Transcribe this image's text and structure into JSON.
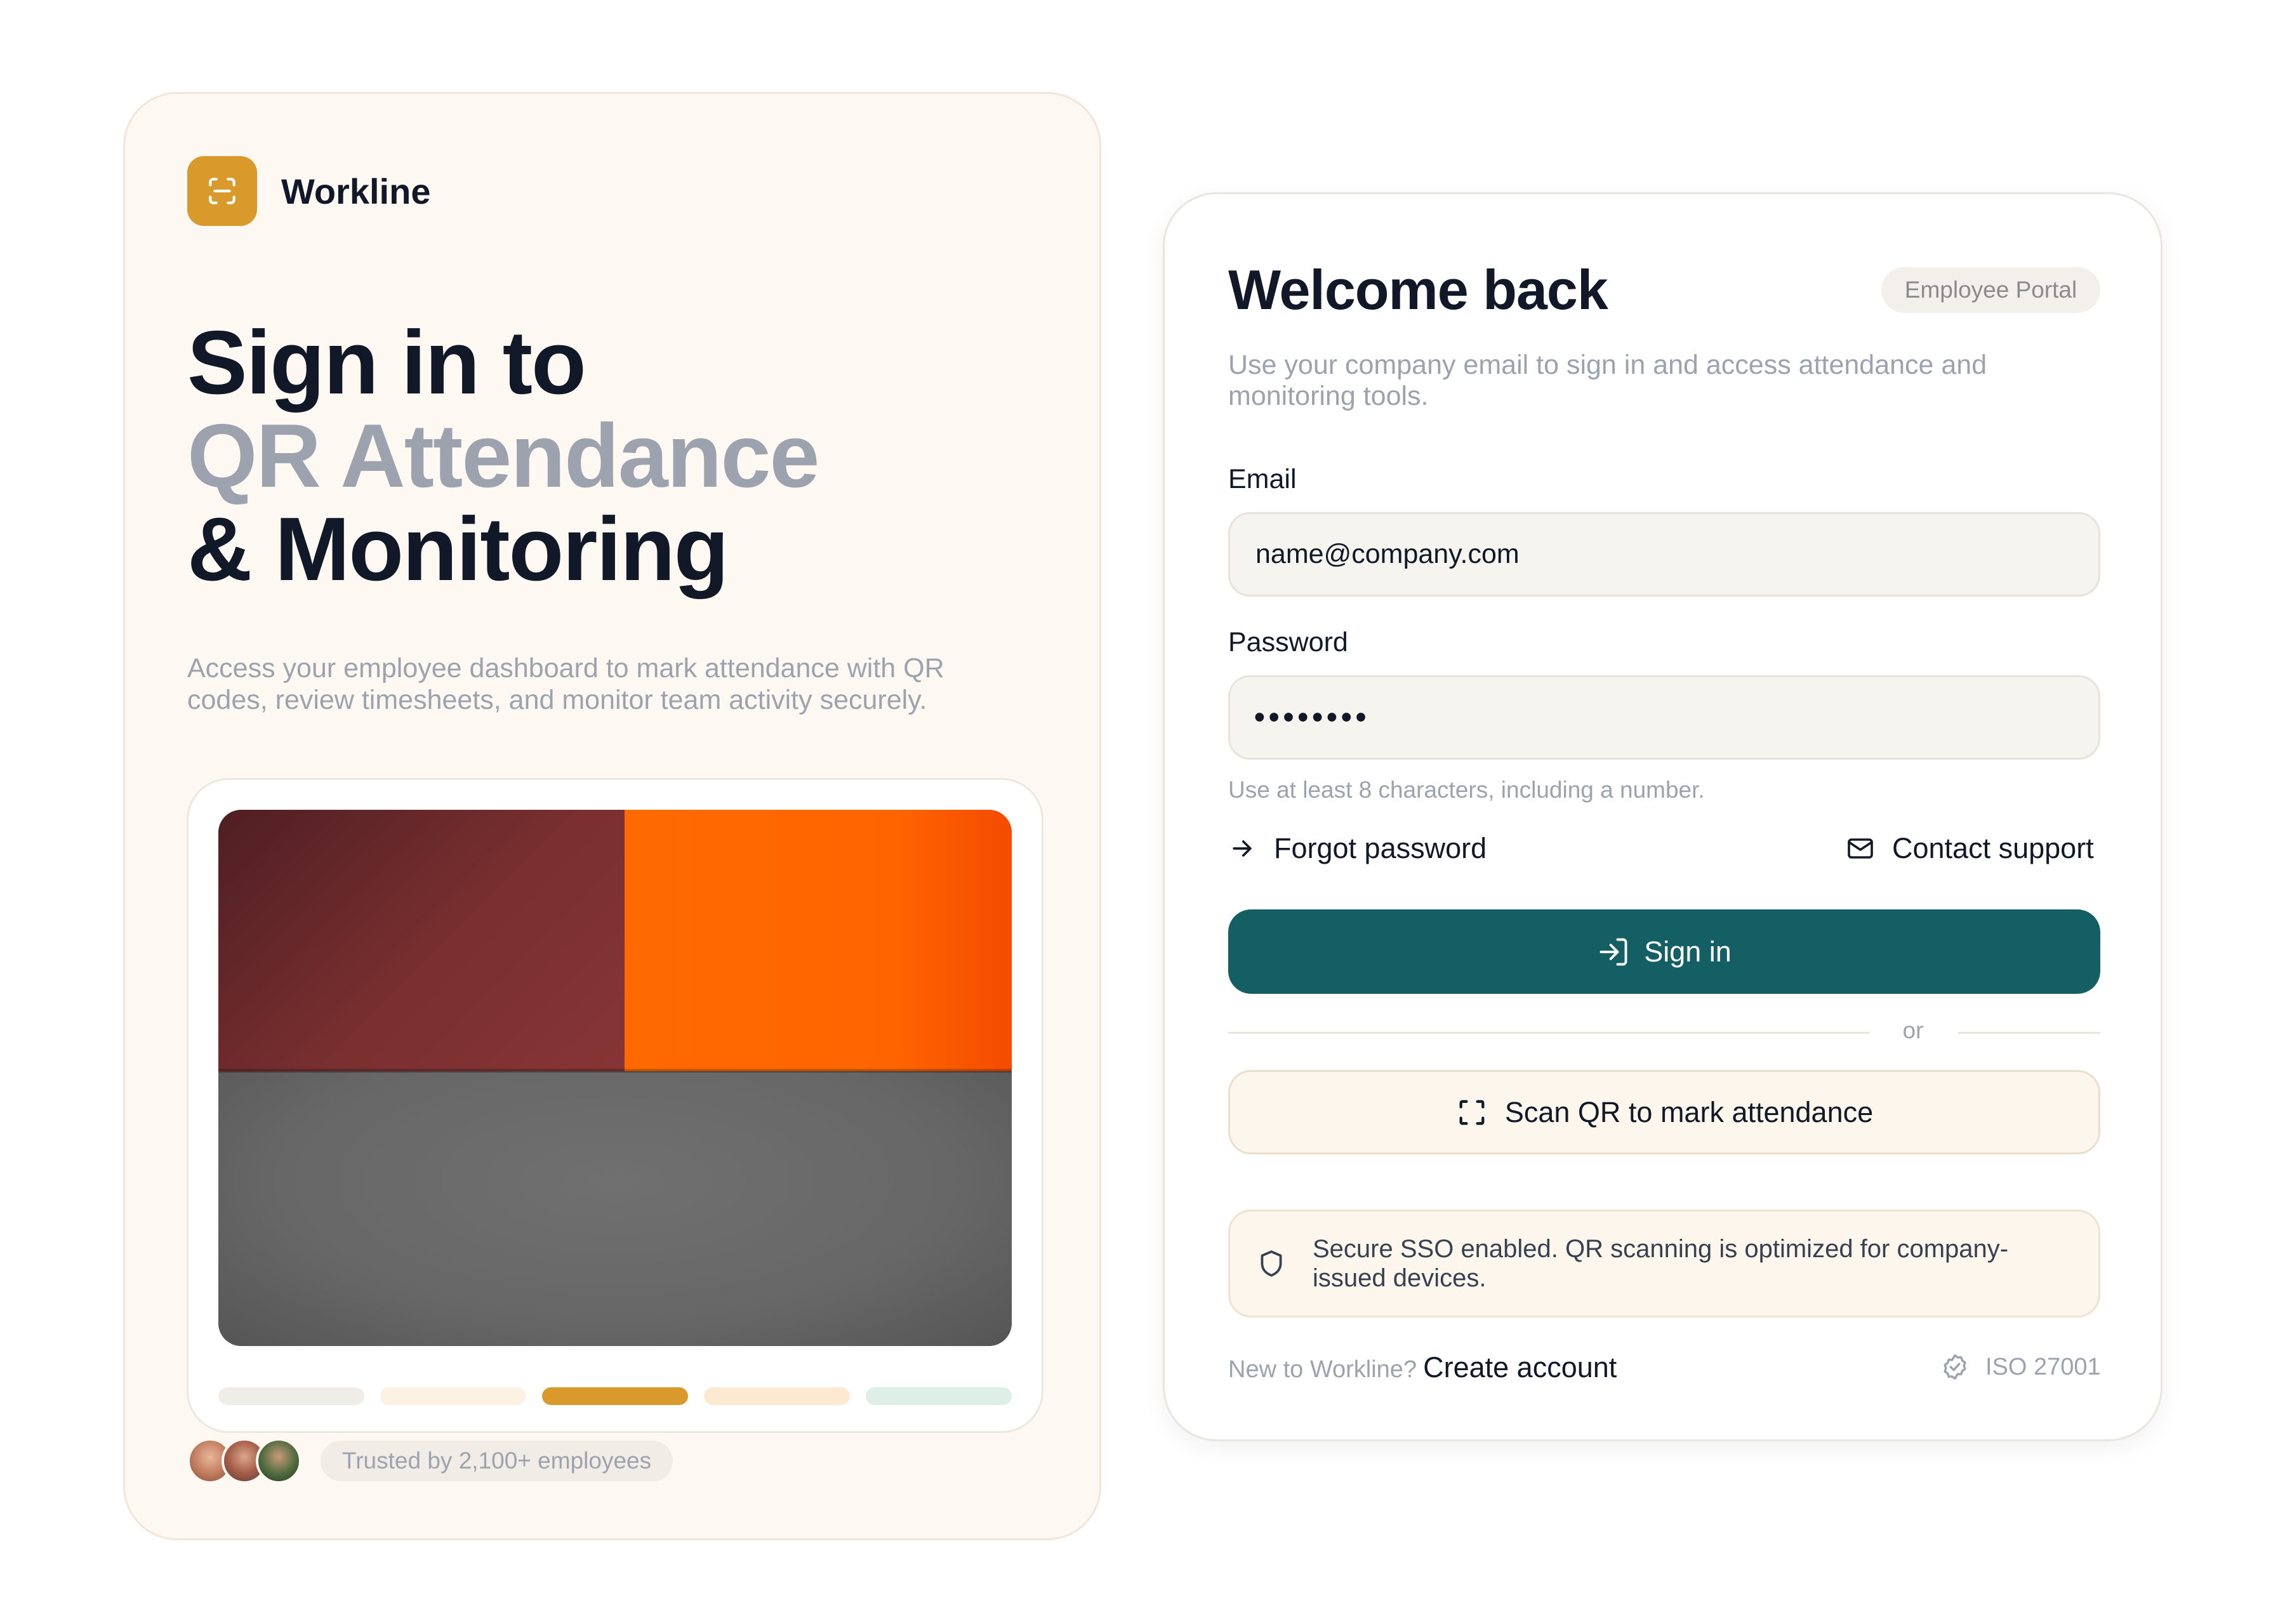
{
  "brand": {
    "name": "Workline",
    "logo_icon": "scan-icon",
    "accent": "#d99a2b"
  },
  "hero": {
    "line1": "Sign in to",
    "line2": "QR Attendance",
    "line3": "& Monitoring",
    "description": "Access your employee dashboard to mark attendance with QR codes, review timesheets, and monitor team activity securely."
  },
  "preview": {
    "segments": [
      {
        "color": "#f0ede9"
      },
      {
        "color": "#fdf1e4"
      },
      {
        "color": "#d99a2b"
      },
      {
        "color": "#fde9d2"
      },
      {
        "color": "#ddefe6"
      }
    ]
  },
  "trust": {
    "label": "Trusted by 2,100+ employees"
  },
  "login": {
    "title": "Welcome back",
    "badge": "Employee Portal",
    "subtitle": "Use your company email to sign in and access attendance and monitoring tools.",
    "email_label": "Email",
    "email_placeholder": "name@company.com",
    "password_label": "Password",
    "password_value": "••••••••",
    "password_hint": "Use at least 8 characters, including a number.",
    "forgot_label": "Forgot password",
    "support_label": "Contact support",
    "signin_label": "Sign in",
    "divider_text": "or",
    "qr_label": "Scan QR to mark attendance",
    "notice": "Secure SSO enabled. QR scanning is optimized for company-issued devices.",
    "footer_prompt": "New to Workline?",
    "create_label": "Create account",
    "iso_label": "ISO 27001",
    "primary_color": "#145f63"
  }
}
